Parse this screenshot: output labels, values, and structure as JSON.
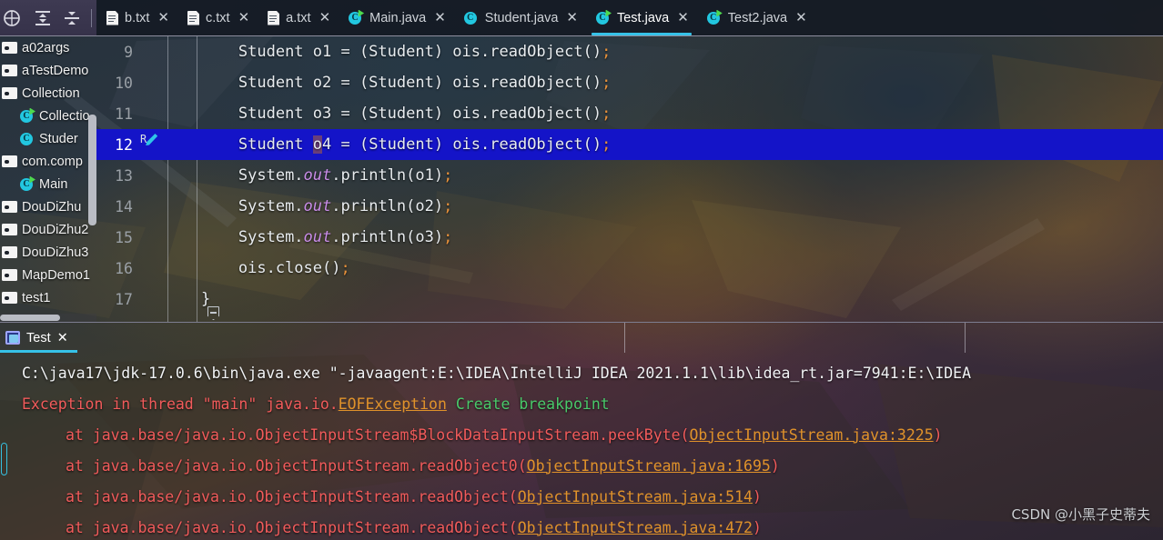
{
  "toolbar": {
    "icons": [
      {
        "name": "select-opened-file-icon",
        "title": "Select Opened File"
      },
      {
        "name": "expand-all-icon",
        "title": "Expand All"
      },
      {
        "name": "collapse-all-icon",
        "title": "Collapse All"
      }
    ]
  },
  "tabs": [
    {
      "label": "b.txt",
      "icon": "text-file-icon",
      "active": false,
      "runnable": false
    },
    {
      "label": "c.txt",
      "icon": "text-file-icon",
      "active": false,
      "runnable": false
    },
    {
      "label": "a.txt",
      "icon": "text-file-icon",
      "active": false,
      "runnable": false
    },
    {
      "label": "Main.java",
      "icon": "java-class-icon",
      "active": false,
      "runnable": true
    },
    {
      "label": "Student.java",
      "icon": "java-class-icon",
      "active": false,
      "runnable": false
    },
    {
      "label": "Test.java",
      "icon": "java-class-icon",
      "active": true,
      "runnable": true
    },
    {
      "label": "Test2.java",
      "icon": "java-class-icon",
      "active": false,
      "runnable": true
    }
  ],
  "tab_close_glyph": "✕",
  "sidebar": {
    "items": [
      {
        "label": "a02args",
        "icon": "folder-icon",
        "indent": 0
      },
      {
        "label": "aTestDemo",
        "icon": "folder-icon",
        "indent": 0
      },
      {
        "label": "Collection",
        "icon": "folder-icon",
        "indent": 0
      },
      {
        "label": "Collectio",
        "icon": "java-class-icon",
        "indent": 1,
        "runnable": true
      },
      {
        "label": "Studer",
        "icon": "java-class-icon",
        "indent": 1,
        "runnable": false
      },
      {
        "label": "com.comp",
        "icon": "folder-icon",
        "indent": 0
      },
      {
        "label": "Main",
        "icon": "java-class-icon",
        "indent": 1,
        "runnable": true
      },
      {
        "label": "DouDiZhu",
        "icon": "folder-icon",
        "indent": 0
      },
      {
        "label": "DouDiZhu2",
        "icon": "folder-icon",
        "indent": 0
      },
      {
        "label": "DouDiZhu3",
        "icon": "folder-icon",
        "indent": 0
      },
      {
        "label": "MapDemo1",
        "icon": "folder-icon",
        "indent": 0
      },
      {
        "label": "test1",
        "icon": "folder-icon",
        "indent": 0
      }
    ]
  },
  "editor": {
    "lines": [
      {
        "num": "9",
        "indent": "        ",
        "pre": "Student o1 = (Student) ois.readObject()",
        "semi": ";",
        "highlighted": false
      },
      {
        "num": "10",
        "indent": "        ",
        "pre": "Student o2 = (Student) ois.readObject()",
        "semi": ";",
        "highlighted": false
      },
      {
        "num": "11",
        "indent": "        ",
        "pre": "Student o3 = (Student) ois.readObject()",
        "semi": ";",
        "highlighted": false
      },
      {
        "num": "12",
        "indent": "        ",
        "a": "Student ",
        "sel": "o",
        "b": "4 = (Student) ois.readObject()",
        "semi": ";",
        "highlighted": true,
        "gutter_hint": "R"
      },
      {
        "num": "13",
        "indent": "        ",
        "sysout": true,
        "a": "System.",
        "kw": "out",
        "b": ".println(o1)",
        "semi": ";",
        "highlighted": false
      },
      {
        "num": "14",
        "indent": "        ",
        "sysout": true,
        "a": "System.",
        "kw": "out",
        "b": ".println(o2)",
        "semi": ";",
        "highlighted": false
      },
      {
        "num": "15",
        "indent": "        ",
        "sysout": true,
        "a": "System.",
        "kw": "out",
        "b": ".println(o3)",
        "semi": ";",
        "highlighted": false
      },
      {
        "num": "16",
        "indent": "        ",
        "pre": "ois.close()",
        "semi": ";",
        "highlighted": false
      },
      {
        "num": "17",
        "indent": "    ",
        "pre": "}",
        "semi": "",
        "highlighted": false,
        "fold": true
      }
    ]
  },
  "run_panel": {
    "tab_label": "Test",
    "tab_icon": "console-icon",
    "tab_close_glyph": "✕",
    "console": {
      "command": "C:\\java17\\jdk-17.0.6\\bin\\java.exe \"-javaagent:E:\\IDEA\\IntelliJ IDEA 2021.1.1\\lib\\idea_rt.jar=7941:E:\\IDEA",
      "exception_line": {
        "prefix": "Exception in thread \"main\" java.io.",
        "link": "EOFException",
        "hint": "Create breakpoint"
      },
      "stack": [
        {
          "text": "at java.base/java.io.ObjectInputStream$BlockDataInputStream.peekByte(",
          "link": "ObjectInputStream.java:3225",
          "suffix": ")"
        },
        {
          "text": "at java.base/java.io.ObjectInputStream.readObject0(",
          "link": "ObjectInputStream.java:1695",
          "suffix": ")"
        },
        {
          "text": "at java.base/java.io.ObjectInputStream.readObject(",
          "link": "ObjectInputStream.java:514",
          "suffix": ")"
        },
        {
          "text": "at java.base/java.io.ObjectInputStream.readObject(",
          "link": "ObjectInputStream.java:472",
          "suffix": ")"
        }
      ]
    }
  },
  "watermark": "CSDN @小黑子史蒂夫",
  "colors": {
    "accent": "#36c2e8",
    "selection": "#1414c8",
    "error": "#f25b5b",
    "link": "#e0922a",
    "hint": "#49c96a",
    "class_icon": "#22c7e0",
    "run_badge": "#4ed94e"
  }
}
